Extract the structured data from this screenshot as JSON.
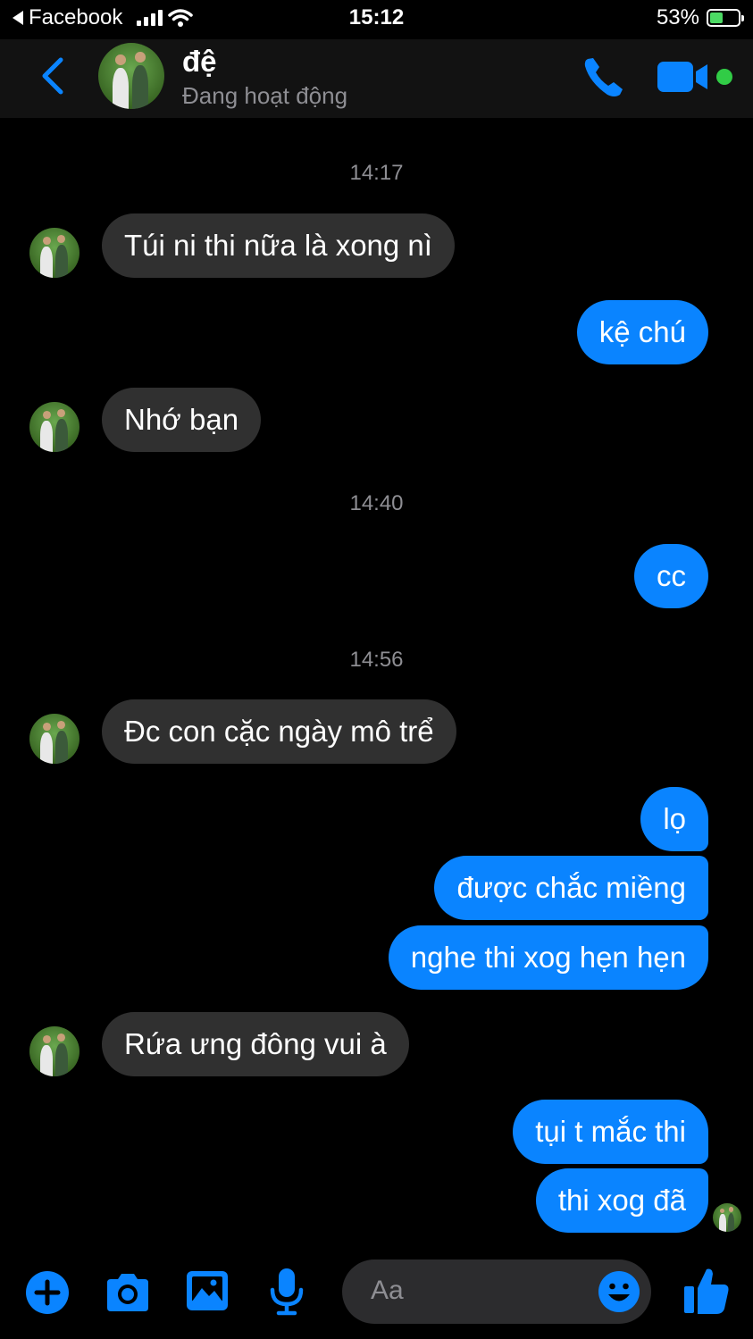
{
  "status_bar": {
    "back_app": "Facebook",
    "time": "15:12",
    "battery": "53%",
    "battery_level": 0.53
  },
  "header": {
    "name": "đệ",
    "status": "Đang hoạt động",
    "accent_color": "#0a84ff",
    "online_color": "#31cc46"
  },
  "timestamps": [
    "14:17",
    "14:40",
    "14:56"
  ],
  "messages": [
    {
      "from": "them",
      "text": "Túi ni thi nữa là xong nì"
    },
    {
      "from": "me",
      "text": "kệ chú"
    },
    {
      "from": "them",
      "text": "Nhớ bạn"
    },
    {
      "from": "me",
      "text": "cc"
    },
    {
      "from": "them",
      "text": "Đc con cặc ngày mô trể"
    },
    {
      "from": "me",
      "text": "lọ"
    },
    {
      "from": "me",
      "text": "được chắc miềng"
    },
    {
      "from": "me",
      "text": "nghe thi xog hẹn hẹn"
    },
    {
      "from": "them",
      "text": "Rứa ưng đông vui à"
    },
    {
      "from": "me",
      "text": "tụi t mắc thi"
    },
    {
      "from": "me",
      "text": "thi xog đã"
    }
  ],
  "composer": {
    "placeholder": "Aa",
    "icons": [
      "plus-icon",
      "camera-icon",
      "image-icon",
      "microphone-icon",
      "emoji-icon",
      "thumbs-up-icon"
    ]
  }
}
